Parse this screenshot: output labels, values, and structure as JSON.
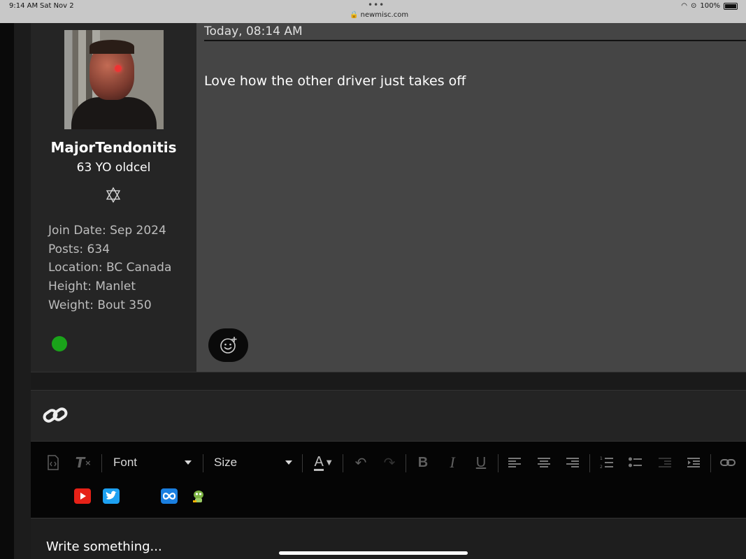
{
  "status_bar": {
    "time": "9:14 AM",
    "date": "Sat Nov 2",
    "url": "newmisc.com",
    "battery": "100%"
  },
  "post": {
    "date": "Today, 08:14 AM",
    "text": "Love how the other driver just takes off"
  },
  "author": {
    "username": "MajorTendonitis",
    "title": "63 YO oldcel",
    "info": [
      "Join Date: Sep 2024",
      "Posts: 634",
      "Location: BC Canada",
      "Height: Manlet",
      "Weight: Bout 350"
    ],
    "online_color": "#1aa31a"
  },
  "toolbar": {
    "font_label": "Font",
    "size_label": "Size"
  },
  "editor": {
    "placeholder": "Write something..."
  },
  "colors": {
    "author_panel": "#252525",
    "post_panel": "#454545",
    "toolbar_bg": "#050505",
    "youtube": "#e62117",
    "twitter": "#1da1f2"
  },
  "icons": [
    "star-of-david-icon",
    "add-emoji-icon",
    "link-icon",
    "source-icon",
    "clear-format-icon",
    "text-color-icon",
    "undo-icon",
    "redo-icon",
    "bold-icon",
    "italic-icon",
    "underline-icon",
    "align-left-icon",
    "align-center-icon",
    "align-right-icon",
    "ordered-list-icon",
    "unordered-list-icon",
    "outdent-icon",
    "indent-icon",
    "insert-link-icon",
    "youtube-icon",
    "twitter-icon",
    "infinity-icon",
    "mascot-icon"
  ]
}
